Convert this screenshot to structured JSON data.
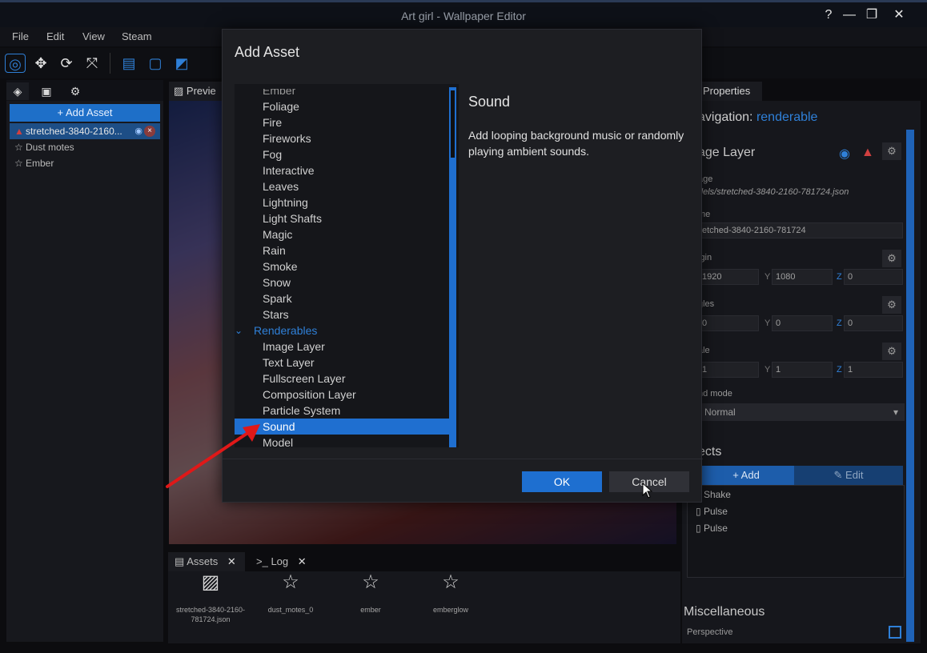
{
  "window": {
    "title": "Art girl - Wallpaper Editor",
    "help_icon": "?",
    "minimize_icon": "—",
    "restore_icon": "❐",
    "close_icon": "✕"
  },
  "menu": [
    "File",
    "Edit",
    "View",
    "Steam"
  ],
  "left_panel": {
    "add_asset_label": "+ Add Asset",
    "layers": [
      {
        "label": "stretched-3840-2160...",
        "selected": true
      },
      {
        "label": "Dust motes",
        "selected": false
      },
      {
        "label": "Ember",
        "selected": false
      }
    ]
  },
  "preview": {
    "tab_label": "Previe"
  },
  "bottom": {
    "tabs": [
      "Assets",
      "Log"
    ],
    "tab_close": "✕",
    "assets": [
      {
        "label": "stretched-3840-2160-781724.json",
        "icon": "image-icon"
      },
      {
        "label": "dust_motes_0",
        "icon": "star-icon"
      },
      {
        "label": "ember",
        "icon": "star-icon"
      },
      {
        "label": "emberglow",
        "icon": "star-icon"
      }
    ]
  },
  "properties": {
    "tab_label": "Properties",
    "navigation_label": "avigation:",
    "navigation_link": "renderable",
    "layer_title": "age Layer",
    "image_label": "age",
    "image_value": "dels/stretched-3840-2160-781724.json",
    "name_label": "me",
    "name_value": "etched-3840-2160-781724",
    "origin_label": "igin",
    "origin": {
      "x": "1920",
      "y_axis": "Y",
      "y": "1080",
      "z_axis": "Z",
      "z": "0"
    },
    "angles_label": "gles",
    "angles": {
      "x": "0",
      "y_axis": "Y",
      "y": "0",
      "z_axis": "Z",
      "z": "0"
    },
    "scale_label": "ale",
    "scale": {
      "x": "1",
      "y_axis": "Y",
      "y": "1",
      "z_axis": "Z",
      "z": "1"
    },
    "blend_label": "nd mode",
    "blend_value": "Normal",
    "effects_title": "ects",
    "add_label": "+ Add",
    "edit_label": "Edit",
    "effects": [
      "Shake",
      "Pulse",
      "Pulse"
    ],
    "misc_title": "Miscellaneous",
    "perspective_label": "Perspective"
  },
  "modal": {
    "title": "Add Asset",
    "items": [
      {
        "label": "Ember",
        "type": "clipped"
      },
      {
        "label": "Foliage",
        "type": "item"
      },
      {
        "label": "Fire",
        "type": "item"
      },
      {
        "label": "Fireworks",
        "type": "item"
      },
      {
        "label": "Fog",
        "type": "item"
      },
      {
        "label": "Interactive",
        "type": "item"
      },
      {
        "label": "Leaves",
        "type": "item"
      },
      {
        "label": "Lightning",
        "type": "item"
      },
      {
        "label": "Light Shafts",
        "type": "item"
      },
      {
        "label": "Magic",
        "type": "item"
      },
      {
        "label": "Rain",
        "type": "item"
      },
      {
        "label": "Smoke",
        "type": "item"
      },
      {
        "label": "Snow",
        "type": "item"
      },
      {
        "label": "Spark",
        "type": "item"
      },
      {
        "label": "Stars",
        "type": "item"
      },
      {
        "label": "Renderables",
        "type": "category"
      },
      {
        "label": "Image Layer",
        "type": "item"
      },
      {
        "label": "Text Layer",
        "type": "item"
      },
      {
        "label": "Fullscreen Layer",
        "type": "item"
      },
      {
        "label": "Composition Layer",
        "type": "item"
      },
      {
        "label": "Particle System",
        "type": "item"
      },
      {
        "label": "Sound",
        "type": "selected"
      },
      {
        "label": "Model",
        "type": "item"
      }
    ],
    "detail_title": "Sound",
    "detail_description": "Add looping background music or randomly playing ambient sounds.",
    "ok_label": "OK",
    "cancel_label": "Cancel"
  },
  "colors": {
    "accent": "#1f6fd0",
    "annotation_arrow": "#e01818"
  }
}
